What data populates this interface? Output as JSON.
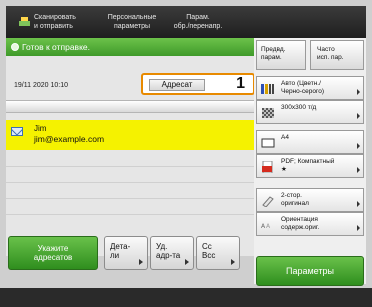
{
  "tabs": [
    {
      "label": "Сканировать\nи отправить"
    },
    {
      "label": "Персональные\nпараметры"
    },
    {
      "label": "Парам.\nобр./перенапр."
    }
  ],
  "status": {
    "text": "Готов к отправке."
  },
  "header": {
    "datetime": "19/11 2020 10:10",
    "destination_label": "Адресат",
    "destination_count": "1"
  },
  "destinations": [
    {
      "name": "Jim",
      "email": "jim@example.com"
    }
  ],
  "bottom_buttons": {
    "specify": "Укажите\nадресатов",
    "details": "Дета-\nли",
    "to": "Уд.\nадр-та",
    "cc": "Сс\nВсс"
  },
  "right_panel": {
    "preview": "Предвд.\nпарам.",
    "frequent": "Часто\nисп. пар.",
    "settings": [
      {
        "icon": "color-icon",
        "text": "Авто (Цветн./\nЧерно-серого)"
      },
      {
        "icon": "resolution-icon",
        "text": "300x300 т/д"
      },
      {
        "icon": "original-size-icon",
        "text": "A4"
      },
      {
        "icon": "pdf-icon",
        "text": "PDF; Компактный\n★"
      },
      {
        "icon": "duplex-icon",
        "text": "2-стор.\nоригинал"
      },
      {
        "icon": "orientation-icon",
        "text": "Ориентация\nсодерж.ориг."
      }
    ],
    "params_button": "Параметры"
  },
  "colors": {
    "green": "#3f9a2a",
    "highlight_row": "#f5f200",
    "destination_border": "#e88a00"
  }
}
